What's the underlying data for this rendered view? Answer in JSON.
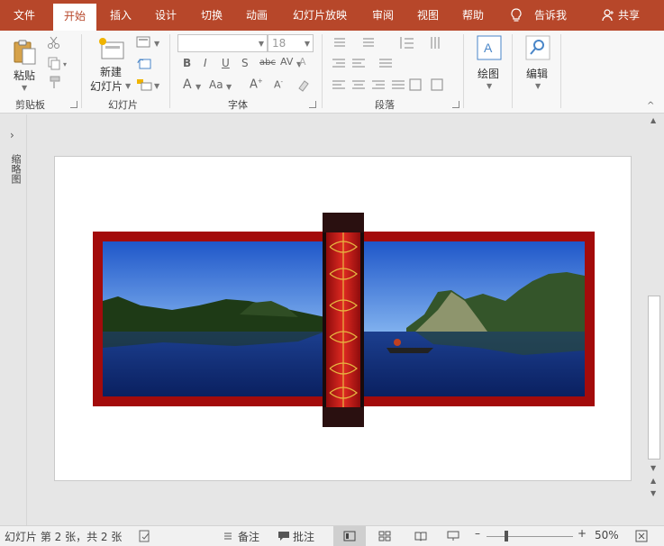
{
  "tabs": [
    "文件",
    "开始",
    "插入",
    "设计",
    "切换",
    "动画",
    "幻灯片放映",
    "审阅",
    "视图",
    "帮助"
  ],
  "tell_me": "告诉我",
  "share": "共享",
  "ribbon": {
    "paste_label": "粘贴",
    "new_slide_label_1": "新建",
    "new_slide_label_2": "幻灯片",
    "font_size": "18",
    "draw_label": "绘图",
    "edit_label": "编辑",
    "groups": {
      "clipboard": "剪贴板",
      "slides": "幻灯片",
      "font": "字体",
      "paragraph": "段落"
    }
  },
  "left_pane": {
    "label": "缩略图"
  },
  "status": {
    "slide_info": "幻灯片 第 2 张，共 2 张",
    "notes": "备注",
    "comments": "批注",
    "zoom": "50%"
  },
  "colors": {
    "accent": "#b7472a",
    "frame_red": "#a30b0b",
    "scroll_red": "#d01e1e",
    "sky": "#2a6ad4",
    "water": "#0e2f80"
  }
}
